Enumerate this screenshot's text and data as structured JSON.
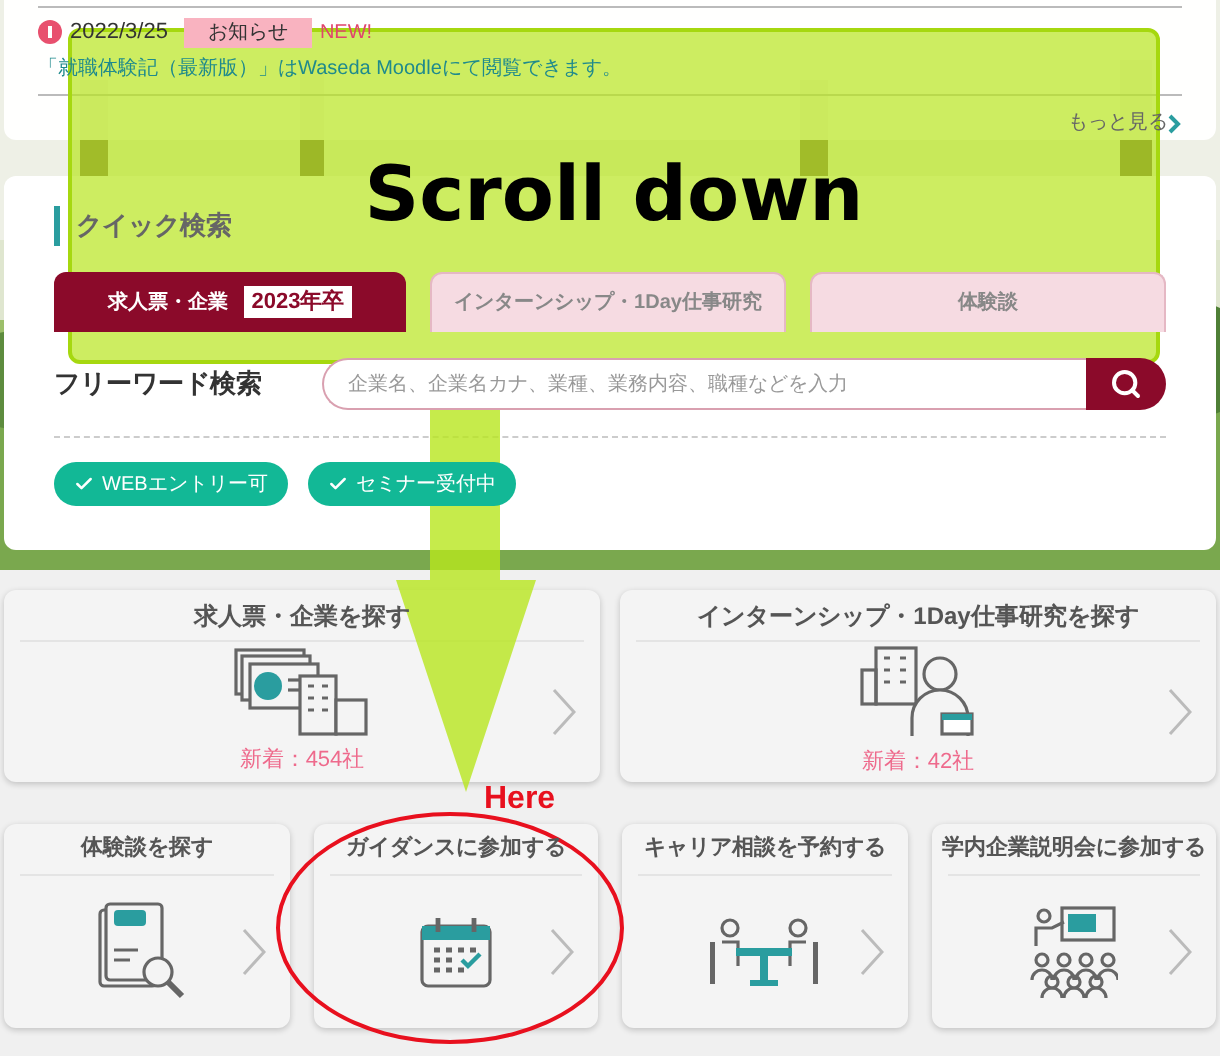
{
  "news": {
    "date": "2022/3/25",
    "tag": "お知らせ",
    "new_label": "NEW!",
    "text": "「就職体験記（最新版）」はWaseda Moodleにて閲覧できます。",
    "more_link": "もっと見る"
  },
  "quick_search": {
    "title": "クイック検索",
    "tabs": [
      {
        "label": "求人票・企業",
        "badge": "2023年卒",
        "selected": true
      },
      {
        "label": "インターンシップ・1Day仕事研究",
        "selected": false
      },
      {
        "label": "体験談",
        "selected": false
      }
    ],
    "freeword_label": "フリーワード検索",
    "search": {
      "placeholder": "企業名、企業名カナ、業種、業務内容、職種などを入力"
    },
    "chips": [
      {
        "label": "WEBエントリー可",
        "checked": true
      },
      {
        "label": "セミナー受付中",
        "checked": true
      }
    ]
  },
  "cards": [
    {
      "title": "求人票・企業を探す",
      "kind": "company",
      "count": "新着：454社"
    },
    {
      "title": "インターンシップ・1Day仕事研究を探す",
      "kind": "intern",
      "count": "新着：42社"
    },
    {
      "title": "体験談を探す",
      "kind": "report"
    },
    {
      "title": "ガイダンスに参加する",
      "kind": "calendar"
    },
    {
      "title": "キャリア相談を予約する",
      "kind": "meeting"
    },
    {
      "title": "学内企業説明会に参加する",
      "kind": "seminar"
    }
  ],
  "annotations": {
    "banner": "Scroll down",
    "pointer": "Here"
  }
}
